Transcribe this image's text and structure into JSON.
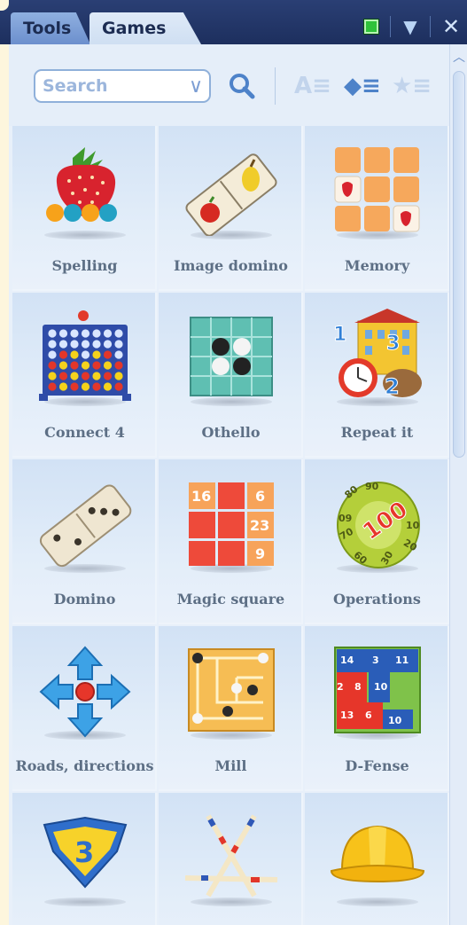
{
  "tabs": [
    {
      "label": "Tools",
      "active": false
    },
    {
      "label": "Games",
      "active": true
    }
  ],
  "window_controls": {
    "window_icon": "green-square-icon",
    "menu_icon": "triangle-down-icon",
    "close_icon": "close-icon",
    "menu_glyph": "▼",
    "close_glyph": "✕"
  },
  "toolbar": {
    "search_placeholder": "Search",
    "search_chevron": "∨",
    "sort_alpha_glyph": "A≡",
    "sort_type_glyph": "◆≡",
    "sort_star_glyph": "★≡"
  },
  "games": [
    {
      "label": "Spelling",
      "icon": "strawberry-icon"
    },
    {
      "label": "Image domino",
      "icon": "image-domino-icon"
    },
    {
      "label": "Memory",
      "icon": "memory-tiles-icon"
    },
    {
      "label": "Connect 4",
      "icon": "connect-four-icon"
    },
    {
      "label": "Othello",
      "icon": "othello-board-icon"
    },
    {
      "label": "Repeat it",
      "icon": "repeat-it-icon"
    },
    {
      "label": "Domino",
      "icon": "domino-icon"
    },
    {
      "label": "Magic square",
      "icon": "magic-square-icon"
    },
    {
      "label": "Operations",
      "icon": "operations-dial-icon"
    },
    {
      "label": "Roads, directions",
      "icon": "directions-arrows-icon"
    },
    {
      "label": "Mill",
      "icon": "mill-board-icon"
    },
    {
      "label": "D-Fense",
      "icon": "hex-board-icon"
    },
    {
      "label": "",
      "icon": "shield-three-icon"
    },
    {
      "label": "",
      "icon": "pick-up-sticks-icon"
    },
    {
      "label": "",
      "icon": "hard-hat-icon"
    }
  ],
  "magic_square": {
    "numbers": [
      "16",
      "6",
      "23",
      "9"
    ]
  },
  "repeat_it": {
    "numbers": [
      "1",
      "3",
      "2"
    ]
  },
  "operations": {
    "center": "100",
    "ring": [
      "80",
      "90",
      "09",
      "10",
      "20",
      "30",
      "70",
      "60"
    ]
  },
  "dfense": {
    "numbers": [
      "14",
      "3",
      "11",
      "2",
      "8",
      "10",
      "13",
      "6",
      "10"
    ]
  },
  "badge": {
    "number": "3"
  },
  "colors": {
    "title_bar": "#1d2f5e",
    "active_tab": "#dfeaf8",
    "inactive_tab": "#7a9bd6",
    "accent_icon": "#4d82c9",
    "label_text": "#5d6f85"
  }
}
